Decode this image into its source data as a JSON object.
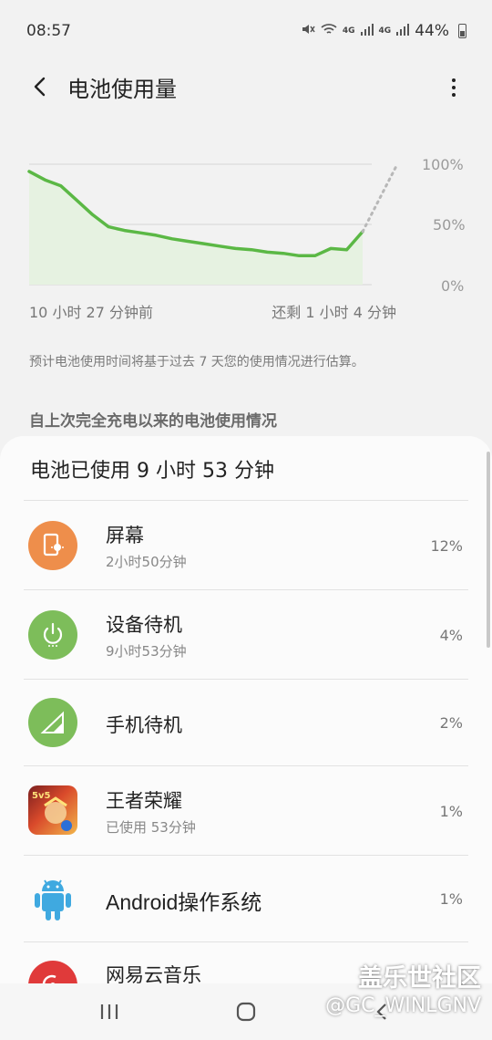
{
  "status_bar": {
    "time": "08:57",
    "network_label": "4G",
    "battery": "44%"
  },
  "header": {
    "title": "电池使用量"
  },
  "chart": {
    "y_ticks": [
      "100%",
      "50%",
      "0%"
    ],
    "start_label": "10 小时 27 分钟前",
    "end_label": "还剩 1 小时 4 分钟",
    "line_color": "#5bb845",
    "fill_color": "#e6f2e1",
    "predict_color": "#b8b8b8"
  },
  "chart_data": {
    "type": "line",
    "title": "",
    "xlabel": "",
    "ylabel": "",
    "ylim": [
      0,
      100
    ],
    "x_start": "10 小时 27 分钟前",
    "x_end": "还剩 1 小时 4 分钟",
    "series": [
      {
        "values": [
          94,
          87,
          82,
          70,
          58,
          48,
          45,
          43,
          41,
          38,
          36,
          34,
          32,
          30,
          29,
          27,
          26,
          24,
          24,
          30,
          29,
          44
        ]
      }
    ],
    "projection": [
      44,
      100
    ]
  },
  "estimate_note": "预计电池使用时间将基于过去 7 天您的使用情况进行估算。",
  "section_heading": "自上次完全充电以来的电池使用情况",
  "usage_card": {
    "title": "电池已使用 9 小时 53 分钟",
    "items": [
      {
        "name": "屏幕",
        "sub": "2小时50分钟",
        "percent": "12%",
        "icon": "screen-icon",
        "color": "#ee8e4b"
      },
      {
        "name": "设备待机",
        "sub": "9小时53分钟",
        "percent": "4%",
        "icon": "power-icon",
        "color": "#7dbd5a"
      },
      {
        "name": "手机待机",
        "sub": "",
        "percent": "2%",
        "icon": "signal-icon",
        "color": "#7dbd5a"
      },
      {
        "name": "王者荣耀",
        "sub": "已使用 53分钟",
        "percent": "1%",
        "icon": "game-icon",
        "color": "#c0392b"
      },
      {
        "name": "Android操作系统",
        "sub": "",
        "percent": "1%",
        "icon": "android-icon",
        "color": "#3fa9e0"
      },
      {
        "name": "网易云音乐",
        "sub": "",
        "percent": "",
        "icon": "music-icon",
        "color": "#e03a3a"
      }
    ]
  },
  "watermark": {
    "line1": "盖乐世社区",
    "line2": "@GC_WINLGNV"
  }
}
